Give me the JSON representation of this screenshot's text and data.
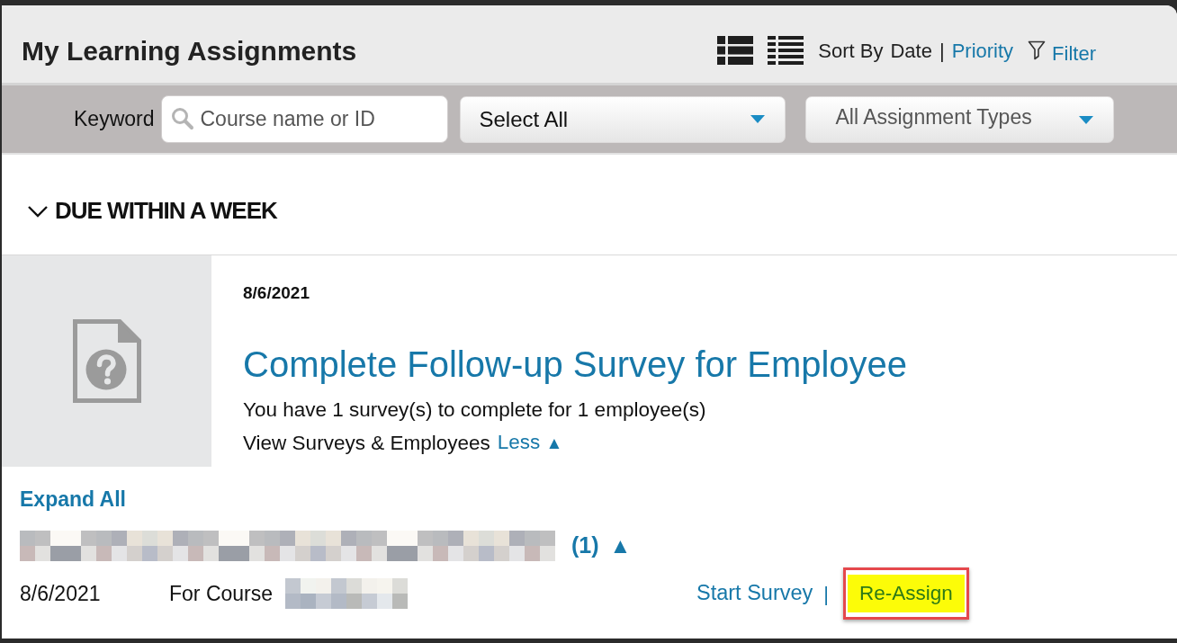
{
  "header": {
    "title": "My Learning Assignments",
    "sort": {
      "label": "Sort By",
      "separator": "|",
      "options": [
        {
          "label": "Date",
          "selected": true
        },
        {
          "label": "Priority",
          "selected": false
        }
      ]
    },
    "filter": {
      "label": "Filter"
    }
  },
  "filter_bar": {
    "keyword_label": "Keyword",
    "search": {
      "placeholder": "Course name or ID"
    },
    "dropdowns": [
      {
        "value": "Select All"
      },
      {
        "value": "All Assignment Types"
      }
    ]
  },
  "section": {
    "title": "DUE WITHIN A WEEK",
    "expanded": true
  },
  "assignment": {
    "date": "8/6/2021",
    "title": "Complete Follow-up Survey for Employee",
    "summary": "You have 1 survey(s) to complete for 1 employee(s)",
    "details_label": "View Surveys & Employees",
    "toggle_label": "Less",
    "toggle_glyph": "▲"
  },
  "expand_all": "Expand All",
  "employees": [
    {
      "count": "(1)",
      "glyph": "▲",
      "surveys": [
        {
          "date": "8/6/2021",
          "course_label": "For Course",
          "separator": "|",
          "actions": [
            {
              "label": "Start Survey",
              "highlighted": false
            },
            {
              "label": "Re-Assign",
              "highlighted": true
            }
          ]
        }
      ]
    }
  ]
}
